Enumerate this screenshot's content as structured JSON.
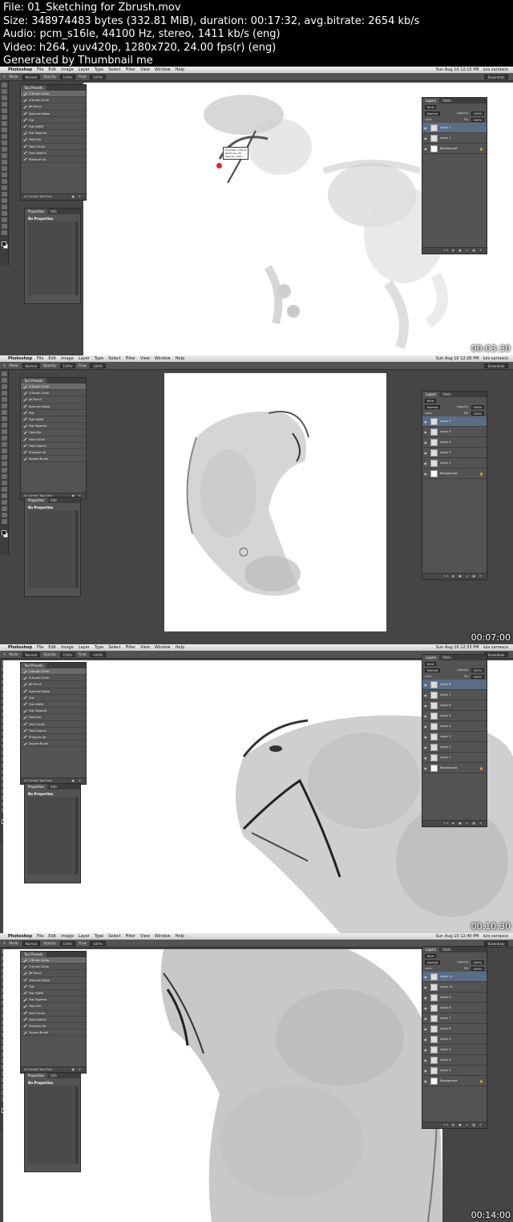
{
  "header": {
    "file": "File: 01_Sketching for Zbrush.mov",
    "size": "Size: 348974483 bytes (332.81 MiB), duration: 00:17:32, avg.bitrate: 2654 kb/s",
    "audio": "Audio: pcm_s16le, 44100 Hz, stereo, 1411 kb/s (eng)",
    "video": "Video: h264, yuv420p, 1280x720, 24.00 fps(r) (eng)",
    "generator": "Generated by Thumbnail me"
  },
  "app": {
    "apple": "",
    "name": "Photoshop",
    "menus": [
      "File",
      "Edit",
      "Image",
      "Layer",
      "Type",
      "Select",
      "Filter",
      "View",
      "Window",
      "Help"
    ],
    "user": "luis carrasco"
  },
  "options": {
    "mode_label": "Mode:",
    "mode_value": "Normal",
    "opacity_label": "Opacity:",
    "opacity_value": "100%",
    "flow_label": "Flow:",
    "flow_value": "100%",
    "workspace": "Essentials"
  },
  "tool_presets": {
    "title": "Tool Presets",
    "items": [
      "2 Brush Circle",
      "3 Brush Circle",
      "JM Pencil",
      "Airbrush Noise",
      "Flat",
      "Flat HARD",
      "Flat Tapered",
      "Hard Ale",
      "Hard Circle",
      "Hard Sketch",
      "Pressure Air",
      "Square Brush"
    ],
    "footer": "Current Tool Only"
  },
  "properties": {
    "tabs": [
      "Properties",
      "Info"
    ],
    "empty": "No Properties"
  },
  "layers": {
    "tabs": [
      "Layers",
      "Paths"
    ],
    "kind": "Kind",
    "blend": "Normal",
    "opacity_label": "Opacity:",
    "opacity": "100%",
    "lock": "Lock:",
    "fill_label": "Fill:",
    "fill": "100%",
    "background_name": "Background",
    "footer_icons": "fx ◐ ▣ ▭ ▦ ✕"
  },
  "frames": [
    {
      "time": "00:03:30",
      "clock": "Sun Aug 10 12:15 PM",
      "presets_shown": 11,
      "layers": [
        "Layer 2",
        "Layer 1"
      ],
      "brush_tip": {
        "l1": "Diameter: 128 px",
        "l2": "Hardness: 0%",
        "l3": "Opacity: 100%"
      }
    },
    {
      "time": "00:07:00",
      "clock": "Sun Aug 10 12:26 PM",
      "presets_shown": 12,
      "layers": [
        "Layer 5",
        "Layer 4",
        "Layer 3",
        "Layer 2",
        "Layer 1"
      ]
    },
    {
      "time": "00:10:30",
      "clock": "Sun Aug 10 12:33 PM",
      "presets_shown": 12,
      "layers": [
        "Layer 8",
        "Layer 7",
        "Layer 6",
        "Layer 5",
        "Layer 4",
        "Layer 3",
        "Layer 2",
        "Layer 1"
      ]
    },
    {
      "time": "00:14:00",
      "clock": "Sun Aug 10 12:40 PM",
      "presets_shown": 12,
      "layers": [
        "Layer 11",
        "Layer 10",
        "Layer 9",
        "Layer 8",
        "Layer 7",
        "Layer 6",
        "Layer 5",
        "Layer 4",
        "Layer 3",
        "Layer 2"
      ]
    }
  ],
  "colors": {
    "ui_dark": "#535353",
    "workspace": "#454545",
    "selected_layer": "#5b6c85",
    "brush_cursor": "#e0262a"
  }
}
